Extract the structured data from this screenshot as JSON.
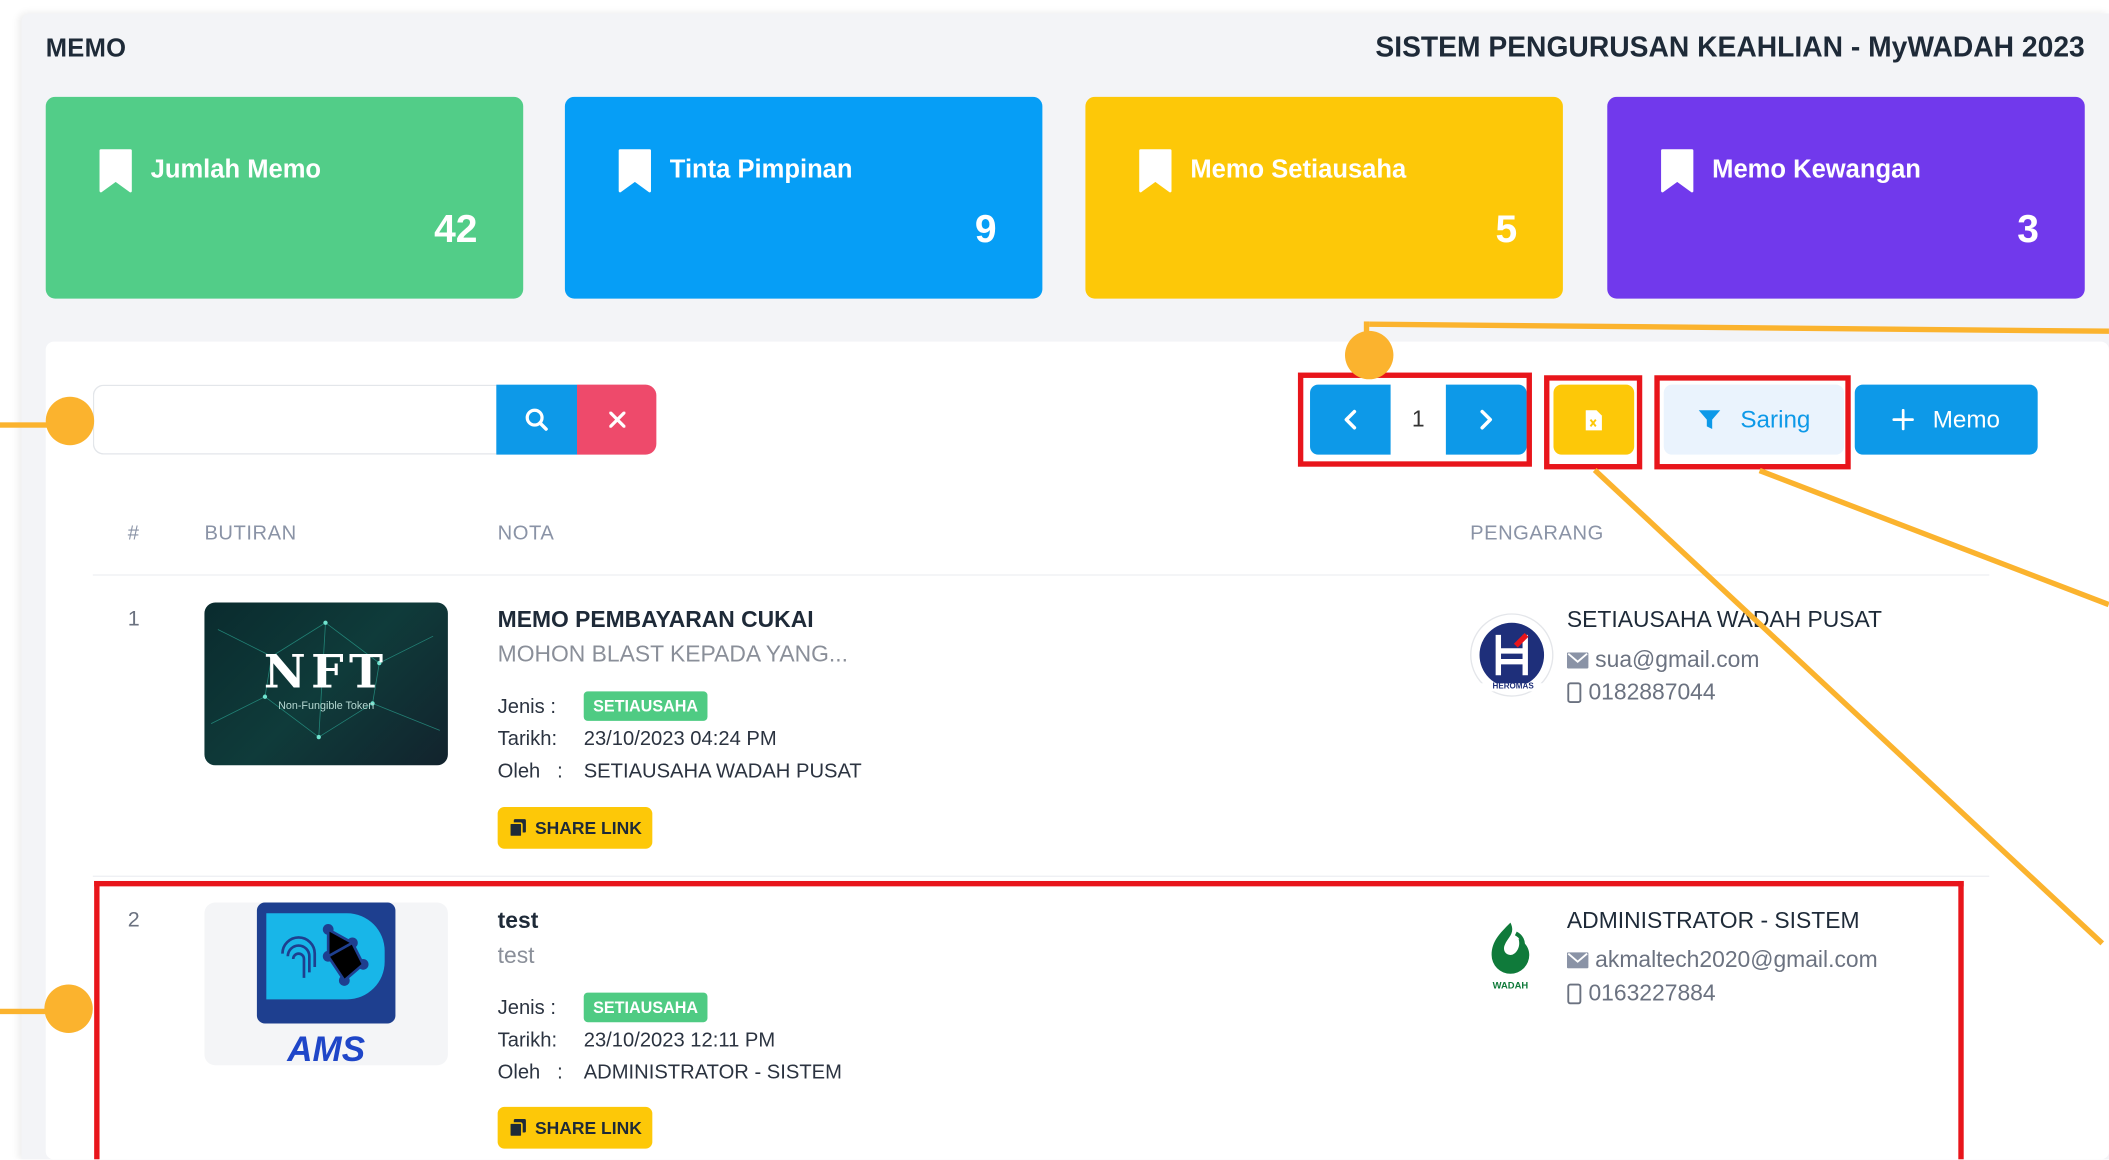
{
  "header": {
    "left_title": "MEMO",
    "right_title": "SISTEM PENGURUSAN KEAHLIAN - MyWADAH 2023"
  },
  "cards": [
    {
      "label": "Jumlah Memo",
      "value": "42",
      "color": "#52cd88"
    },
    {
      "label": "Tinta Pimpinan",
      "value": "9",
      "color": "#069ef6"
    },
    {
      "label": "Memo Setiausaha",
      "value": "5",
      "color": "#fdc808"
    },
    {
      "label": "Memo Kewangan",
      "value": "3",
      "color": "#7139ec"
    }
  ],
  "toolbar": {
    "search_value": "",
    "page": "1",
    "filter_label": "Saring",
    "add_label": "Memo"
  },
  "table": {
    "headers": {
      "num": "#",
      "butiran": "BUTIRAN",
      "nota": "NOTA",
      "pengarang": "PENGARANG"
    }
  },
  "meta_labels": {
    "jenis": "Jenis :",
    "tarikh": "Tarikh:",
    "oleh": "Oleh   :"
  },
  "rows": [
    {
      "num": "1",
      "title": "MEMO PEMBAYARAN CUKAI",
      "subtitle": "MOHON BLAST KEPADA YANG...",
      "jenis": "SETIAUSAHA",
      "tarikh": "23/10/2023 04:24 PM",
      "oleh": "SETIAUSAHA WADAH PUSAT",
      "share_label": "SHARE LINK",
      "thumb_text": "NFT",
      "thumb_sub": "Non-Fungible Token",
      "author_name": "SETIAUSAHA WADAH PUSAT",
      "author_email": "sua@gmail.com",
      "author_phone": "0182887044",
      "author_logo_text": "HEROMAS"
    },
    {
      "num": "2",
      "title": "test",
      "subtitle": "test",
      "jenis": "SETIAUSAHA",
      "tarikh": "23/10/2023 12:11 PM",
      "oleh": "ADMINISTRATOR - SISTEM",
      "share_label": "SHARE LINK",
      "thumb_text": "AMS",
      "author_name": "ADMINISTRATOR - SISTEM",
      "author_email": "akmaltech2020@gmail.com",
      "author_phone": "0163227884",
      "author_logo_text": "WADAH"
    }
  ],
  "colors": {
    "primary": "#0d99e8",
    "danger": "#ee4a6b",
    "warning": "#fdc808",
    "success": "#4fcb83",
    "annotation_red": "#e8151b",
    "annotation_orange": "#fbb32e"
  },
  "icons": {
    "card": "bookmark-icon",
    "search": "search-icon",
    "clear": "close-icon",
    "prev": "chevron-left-icon",
    "next": "chevron-right-icon",
    "excel": "excel-file-icon",
    "filter": "funnel-icon",
    "add": "plus-icon",
    "share": "copy-icon",
    "email": "envelope-icon",
    "phone": "phone-icon"
  }
}
